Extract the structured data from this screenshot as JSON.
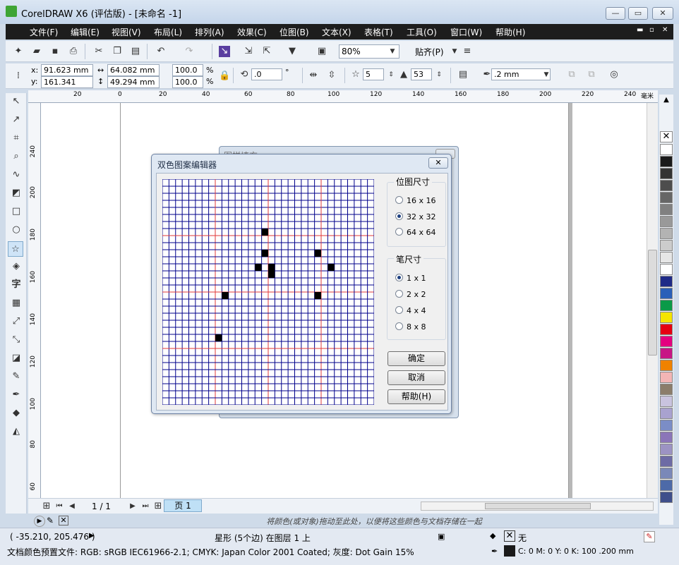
{
  "window": {
    "title": "CorelDRAW X6 (评估版) - [未命名 -1]",
    "minimize": "—",
    "restore": "▭",
    "close": "✕"
  },
  "menu": [
    "文件(F)",
    "编辑(E)",
    "视图(V)",
    "布局(L)",
    "排列(A)",
    "效果(C)",
    "位图(B)",
    "文本(X)",
    "表格(T)",
    "工具(O)",
    "窗口(W)",
    "帮助(H)"
  ],
  "standard_toolbar": {
    "zoom": "80%",
    "snap": "贴齐(P)"
  },
  "property_bar": {
    "x": "91.623 mm",
    "y": "161.341 mm",
    "width": "64.082 mm",
    "height": "49.294 mm",
    "scale_x": "100.0",
    "scale_y": "100.0",
    "percent": "%",
    "rotation": ".0",
    "degree": "°",
    "points": "5",
    "sharpness": "53",
    "outline": ".2 mm"
  },
  "ruler": {
    "h_ticks": [
      "20",
      "0",
      "20",
      "40",
      "60",
      "80",
      "100",
      "120",
      "140",
      "160",
      "180",
      "200",
      "220",
      "240"
    ],
    "unit": "毫米",
    "v_ticks": [
      "240",
      "220",
      "200",
      "180",
      "160",
      "140",
      "120",
      "100",
      "80",
      "60"
    ]
  },
  "page_nav": {
    "counter": "1 / 1",
    "tab": "页 1"
  },
  "hint": "将颜色(或对象)拖动至此处，以便将这些颜色与文档存储在一起",
  "status": {
    "coords": "( -35.210, 205.476 )",
    "object": "星形 (5个边) 在图层 1 上",
    "profile": "文档颜色预置文件: RGB: sRGB IEC61966-2.1; CMYK: Japan Color 2001 Coated; 灰度: Dot Gain 15%",
    "fill_none": "无",
    "outline_color": "C: 0 M: 0 Y: 0 K: 100  .200 mm"
  },
  "background_dialog": {
    "title": "图样填充"
  },
  "dialog": {
    "title": "双色图案编辑器",
    "close": "✕",
    "bitmap_size": {
      "label": "位图尺寸",
      "options": [
        "16 x 16",
        "32 x 32",
        "64 x 64"
      ],
      "selected": 1
    },
    "pen_size": {
      "label": "笔尺寸",
      "options": [
        "1 x 1",
        "2 x 2",
        "4 x 4",
        "8 x 8"
      ],
      "selected": 0
    },
    "buttons": {
      "ok": "确定",
      "cancel": "取消",
      "help": "帮助(H)"
    },
    "grid": {
      "size": 32,
      "filled": [
        [
          15,
          7
        ],
        [
          15,
          10
        ],
        [
          23,
          10
        ],
        [
          14,
          12
        ],
        [
          16,
          12
        ],
        [
          25,
          12
        ],
        [
          16,
          13
        ],
        [
          9,
          16
        ],
        [
          23,
          16
        ],
        [
          8,
          22
        ]
      ]
    }
  },
  "colors": {
    "accent": "#1d1d1d",
    "grid_line": "#00008b",
    "guide_line": "#e23a3a",
    "fill": "#000000"
  },
  "palette": [
    "#ffffff",
    "#1a1a1a",
    "#333333",
    "#4d4d4d",
    "#666666",
    "#808080",
    "#999999",
    "#b3b3b3",
    "#cccccc",
    "#e6e6e6",
    "#ffffff",
    "#1e2a87",
    "#2b5fb8",
    "#0a9a48",
    "#f5e400",
    "#e60012",
    "#e4007f",
    "#c71585",
    "#f08200",
    "#f3b5b5",
    "#8b7d6b",
    "#c9c3df",
    "#a9a2cf",
    "#7b8dc6",
    "#8b75b8",
    "#9c93c3",
    "#6d6ba5",
    "#7a88b8",
    "#4d6aa8",
    "#3f4f8b",
    "#5b86c5",
    "#6a7fa6",
    "#3a4c7a"
  ],
  "tools": [
    "pick-tool",
    "shape-tool",
    "crop-tool",
    "zoom-tool",
    "freehand-tool",
    "smart-fill-tool",
    "rectangle-tool",
    "ellipse-tool",
    "star-tool",
    "basic-shapes-tool",
    "text-tool",
    "table-tool",
    "dimension-tool",
    "connector-tool",
    "blend-tool",
    "eyedropper-tool",
    "outline-tool",
    "fill-tool",
    "interactive-fill-tool"
  ]
}
